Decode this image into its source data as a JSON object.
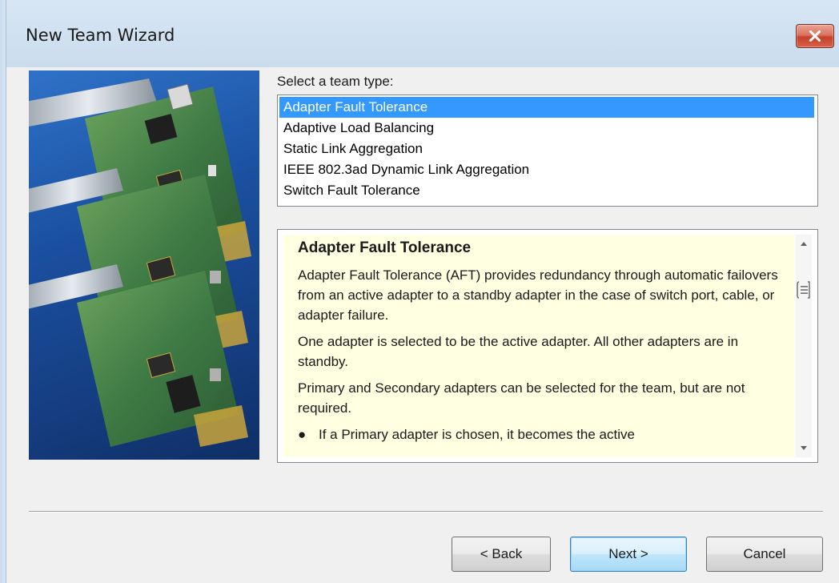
{
  "window": {
    "title": "New Team Wizard"
  },
  "team_type": {
    "label": "Select a team type:",
    "options": [
      "Adapter Fault Tolerance",
      "Adaptive Load Balancing",
      "Static Link Aggregation",
      "IEEE 802.3ad Dynamic Link Aggregation",
      "Switch Fault Tolerance"
    ],
    "selected": "Adapter Fault Tolerance"
  },
  "description": {
    "title": "Adapter Fault Tolerance",
    "paragraphs": [
      "Adapter Fault Tolerance (AFT) provides redundancy through automatic failovers from an active adapter to a standby adapter in the case of switch port, cable, or adapter failure.",
      "One adapter is selected to be the active adapter. All other adapters are in standby.",
      "Primary and Secondary adapters can be selected for the team, but are not required."
    ],
    "bullet": "If a Primary adapter is chosen, it becomes the active"
  },
  "buttons": {
    "back": "< Back",
    "next": "Next >",
    "cancel": "Cancel"
  },
  "colors": {
    "selection": "#3399ff",
    "description_bg": "#ffffe1",
    "close_button": "#c4412a"
  },
  "icons": {
    "close": "close-icon",
    "scroll_up": "scroll-up-icon",
    "scroll_down": "scroll-down-icon"
  }
}
